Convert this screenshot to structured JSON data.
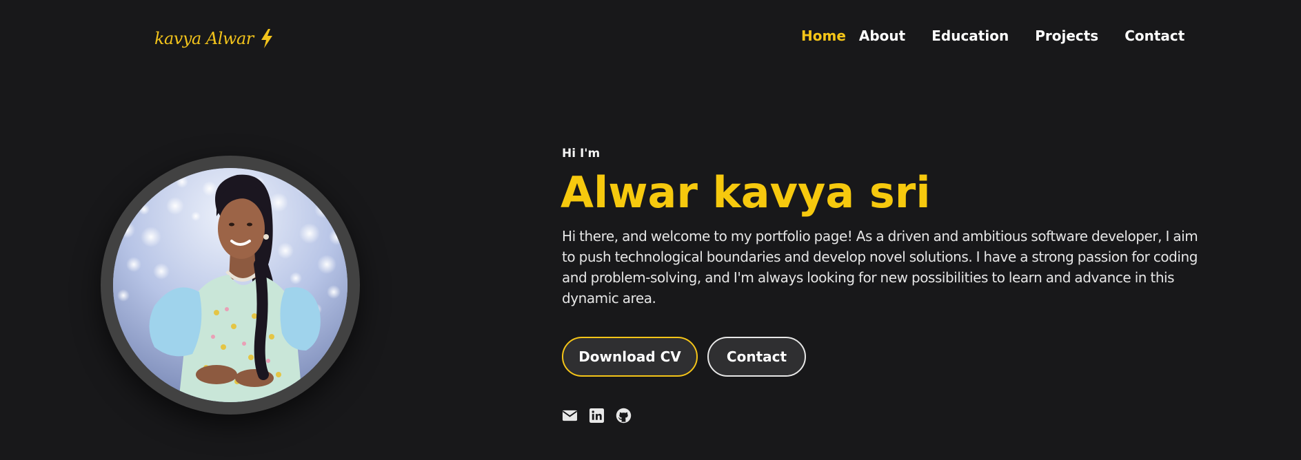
{
  "header": {
    "logo_text": "kavya Alwar",
    "logo_icon": "lightning-bolt-icon",
    "nav": [
      {
        "label": "Home",
        "active": true
      },
      {
        "label": "About",
        "active": false
      },
      {
        "label": "Education",
        "active": false
      },
      {
        "label": "Projects",
        "active": false
      },
      {
        "label": "Contact",
        "active": false
      }
    ]
  },
  "hero": {
    "greeting": "Hi I'm",
    "name": "Alwar kavya sri",
    "bio": "Hi there, and welcome to my portfolio page! As a driven and ambitious software developer, I aim to push technological boundaries and develop novel solutions. I have a strong passion for coding and problem-solving, and I'm always looking for new possibilities to learn and advance in this dynamic area.",
    "buttons": {
      "download_cv": "Download CV",
      "contact": "Contact"
    },
    "socials": [
      "email-icon",
      "linkedin-icon",
      "github-icon"
    ]
  },
  "colors": {
    "background": "#18181a",
    "accent": "#f5c518",
    "button_bg": "#2f2f31",
    "photo_ring": "#424242"
  }
}
